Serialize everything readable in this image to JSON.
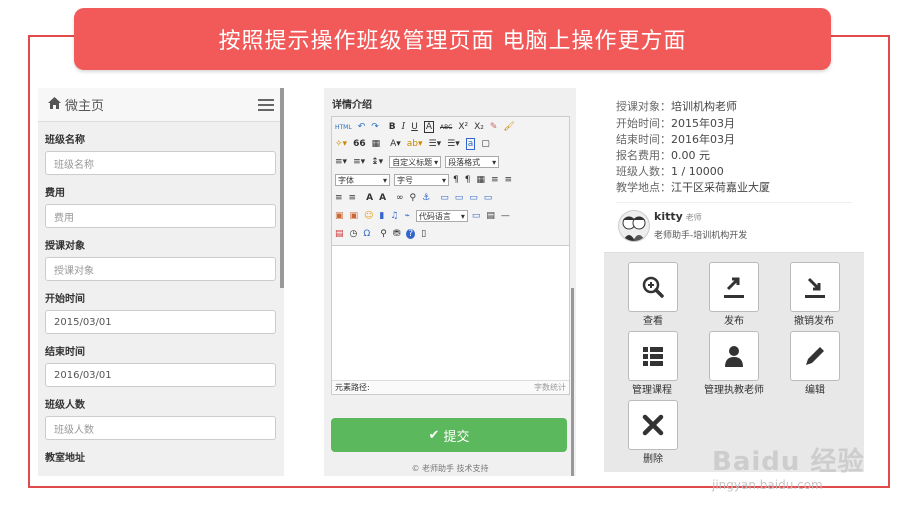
{
  "banner": {
    "text": "按照提示操作班级管理页面 电脑上操作更方面"
  },
  "left_panel": {
    "title": "微主页",
    "fields": [
      {
        "label": "班级名称",
        "placeholder": "班级名称",
        "value": ""
      },
      {
        "label": "费用",
        "placeholder": "费用",
        "value": ""
      },
      {
        "label": "授课对象",
        "placeholder": "授课对象",
        "value": ""
      },
      {
        "label": "开始时间",
        "placeholder": "",
        "value": "2015/03/01"
      },
      {
        "label": "结束时间",
        "placeholder": "",
        "value": "2016/03/01"
      },
      {
        "label": "班级人数",
        "placeholder": "班级人数",
        "value": ""
      },
      {
        "label": "教室地址",
        "placeholder": "",
        "value": ""
      }
    ]
  },
  "editor_panel": {
    "title": "详情介绍",
    "toolbar": {
      "row1": [
        "HTML",
        "↶",
        "↷",
        "B",
        "I",
        "U",
        "A",
        "ABC",
        "X²",
        "X₂",
        "✎",
        "🖌"
      ],
      "row2": [
        "✧▾",
        "66",
        "▦",
        "A▾",
        "ab▾",
        "☰▾",
        "☰▾",
        "a",
        "▢"
      ],
      "row3": [
        "≡▾",
        "≡▾",
        "↨▾"
      ],
      "custom_heading": "自定义标题",
      "paragraph_format": "段落格式",
      "font_family": "字体",
      "font_size": "字号",
      "row4": [
        "¶",
        "¶",
        "▦",
        "≡",
        "≡"
      ],
      "row5": [
        "≡",
        "≡",
        "A",
        "A",
        "∞",
        "⚲",
        "⚓",
        "▭",
        "▭",
        "▭",
        "▭"
      ],
      "row6": [
        "▣",
        "▣",
        "☺",
        "▮",
        "♫",
        "⌁"
      ],
      "code_language": "代码语言",
      "row7": [
        "▤",
        "◷",
        "Ω",
        "⚲",
        "⛃",
        "?",
        "▯"
      ]
    },
    "element_path": "元素路径:",
    "word_count": "字数统计",
    "submit_label": "提交",
    "support": "© 老师助手 技术支持"
  },
  "right_panel": {
    "info": [
      {
        "label": "授课对象：",
        "value": "培训机构老师"
      },
      {
        "label": "开始时间：",
        "value": "2015年03月"
      },
      {
        "label": "结束时间：",
        "value": "2016年03月"
      },
      {
        "label": "报名费用：",
        "value": "0.00 元"
      },
      {
        "label": "班级人数：",
        "value": "1 / 10000"
      },
      {
        "label": "教学地点：",
        "value": "江干区采荷嘉业大厦"
      }
    ],
    "teacher": {
      "name": "kitty",
      "role": "老师",
      "desc": "老师助手-培训机构开发"
    },
    "actions": [
      {
        "label": "查看",
        "icon": "zoom-in-icon"
      },
      {
        "label": "发布",
        "icon": "publish-icon"
      },
      {
        "label": "撤销发布",
        "icon": "unpublish-icon"
      },
      {
        "label": "管理课程",
        "icon": "list-icon"
      },
      {
        "label": "管理执教老师",
        "icon": "user-icon"
      },
      {
        "label": "编辑",
        "icon": "pencil-icon"
      },
      {
        "label": "删除",
        "icon": "close-icon"
      }
    ]
  },
  "watermark": {
    "text": "Baidu 经验",
    "url": "jingyan.baidu.com"
  },
  "colors": {
    "banner": "#f25a5a",
    "frame": "#e04a4a",
    "submit": "#5cb85c"
  }
}
